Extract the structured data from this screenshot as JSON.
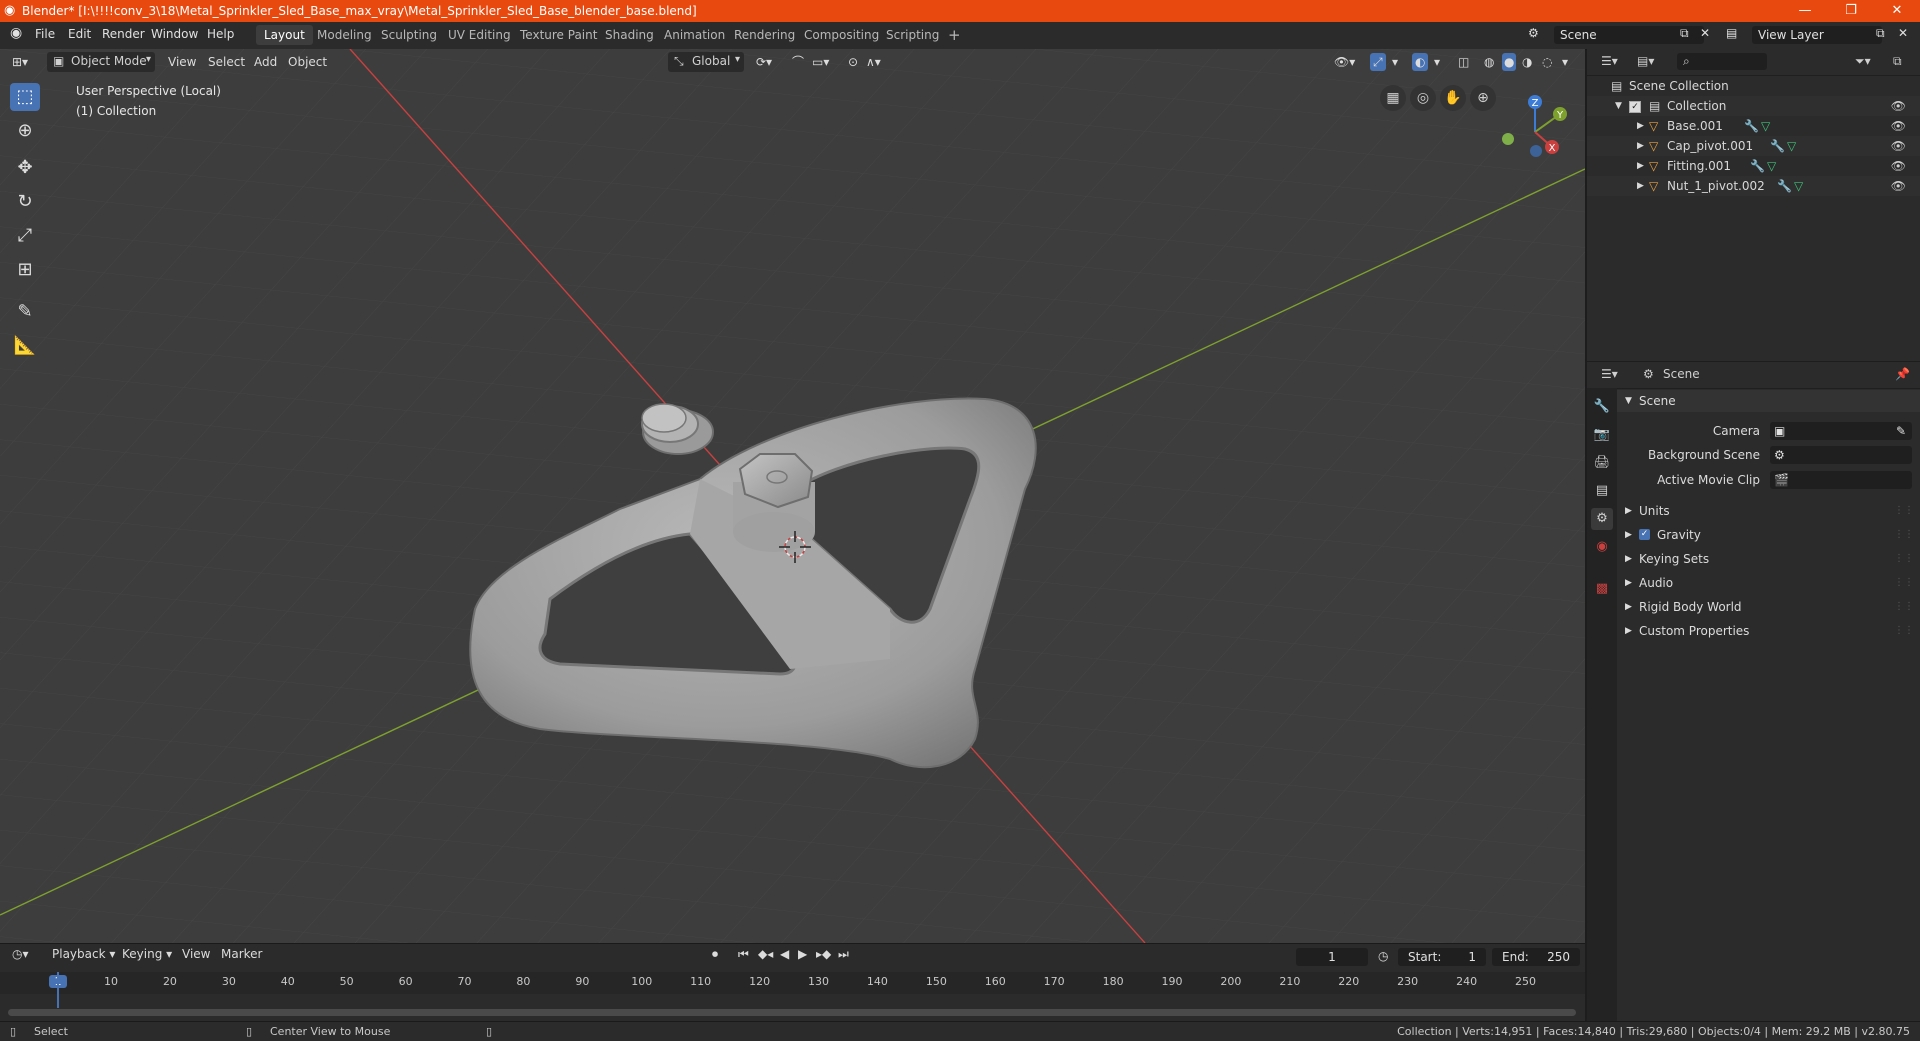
{
  "window": {
    "title": "Blender* [I:\\!!!!conv_3\\18\\Metal_Sprinkler_Sled_Base_max_vray\\Metal_Sprinkler_Sled_Base_blender_base.blend]",
    "minimize": "—",
    "maximize": "❐",
    "close": "✕"
  },
  "menu": [
    "File",
    "Edit",
    "Render",
    "Window",
    "Help"
  ],
  "workspaces": [
    "Layout",
    "Modeling",
    "Sculpting",
    "UV Editing",
    "Texture Paint",
    "Shading",
    "Animation",
    "Rendering",
    "Compositing",
    "Scripting"
  ],
  "add_workspace": "+",
  "scene_field": "Scene",
  "view_layer_field": "View Layer",
  "viewport": {
    "mode": "Object Mode",
    "menus": [
      "View",
      "Select",
      "Add",
      "Object"
    ],
    "orientation": "Global",
    "overlay_line1": "User Perspective (Local)",
    "overlay_line2": "(1) Collection",
    "gizmo": {
      "z": "Z",
      "y": "Y",
      "x": "X"
    }
  },
  "outliner": {
    "root": "Scene Collection",
    "collection": "Collection",
    "objects": [
      "Base.001",
      "Cap_pivot.001",
      "Fitting.001",
      "Nut_1_pivot.002"
    ]
  },
  "properties": {
    "header": "Scene",
    "panel": "Scene",
    "camera_label": "Camera",
    "bg_scene_label": "Background Scene",
    "movie_clip_label": "Active Movie Clip",
    "subpanels": [
      "Units",
      "Gravity",
      "Keying Sets",
      "Audio",
      "Rigid Body World",
      "Custom Properties"
    ],
    "gravity_checked": true
  },
  "timeline": {
    "menus": [
      "Playback",
      "Keying",
      "View",
      "Marker"
    ],
    "current_frame": "1",
    "start_label": "Start:",
    "start_value": "1",
    "end_label": "End:",
    "end_value": "250",
    "ticks": [
      "1",
      "10",
      "20",
      "30",
      "40",
      "50",
      "60",
      "70",
      "80",
      "90",
      "100",
      "110",
      "120",
      "130",
      "140",
      "150",
      "160",
      "170",
      "180",
      "190",
      "200",
      "210",
      "220",
      "230",
      "240",
      "250"
    ]
  },
  "status": {
    "left": "Select",
    "middle": "Center View to Mouse",
    "right": "Collection | Verts:14,951 | Faces:14,840 | Tris:29,680 | Objects:0/4 | Mem: 29.2 MB | v2.80.75"
  },
  "colors": {
    "title_bar": "#e8490f",
    "accent": "#4772b3",
    "x_axis": "#c9403f",
    "y_axis": "#7ea12e",
    "object_orange": "#e8a040"
  }
}
